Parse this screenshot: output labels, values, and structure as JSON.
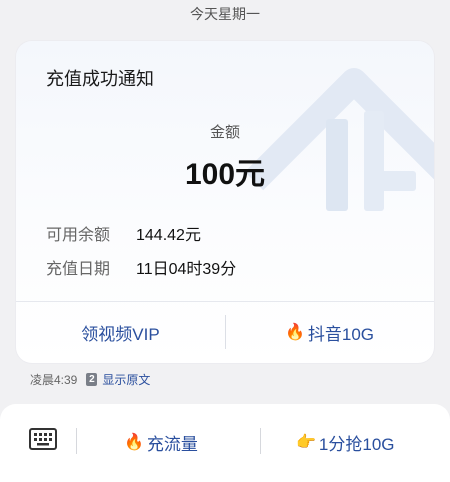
{
  "header": {
    "date": "今天星期一"
  },
  "card": {
    "title": "充值成功通知",
    "amount_label": "金额",
    "amount_value": "100元",
    "rows": [
      {
        "label": "可用余额",
        "value": "144.42元"
      },
      {
        "label": "充值日期",
        "value": "11日04时39分"
      }
    ],
    "actions": [
      {
        "label": "领视频VIP",
        "icon": ""
      },
      {
        "label": "抖音10G",
        "icon": "🔥"
      }
    ]
  },
  "meta": {
    "time": "凌晨4:39",
    "badge": "2",
    "link": "显示原文"
  },
  "bottom_bar": {
    "keyboard_icon": "keyboard-icon",
    "buttons": [
      {
        "label": "充流量",
        "icon": "🔥"
      },
      {
        "label": "1分抢10G",
        "icon": "👉"
      }
    ]
  },
  "colors": {
    "link": "#2a4f9e",
    "background": "#f1f1f3",
    "card_bg": "#f4f7fc"
  }
}
